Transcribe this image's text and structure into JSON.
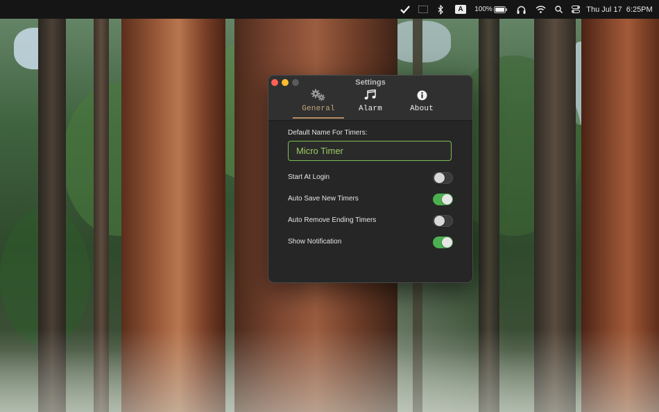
{
  "menubar": {
    "battery_percent": "100%",
    "input_source": "A",
    "datetime": "Thu Jul 17  6:25PM",
    "icons": [
      "checkmark-icon",
      "window-icon",
      "bluetooth-icon",
      "input-source-icon",
      "battery-icon",
      "headphones-icon",
      "wifi-icon",
      "search-icon",
      "control-center-icon"
    ]
  },
  "window": {
    "title": "Settings",
    "tabs": [
      {
        "label": "General",
        "icon": "gears-icon",
        "active": true
      },
      {
        "label": "Alarm",
        "icon": "music-notes-icon",
        "active": false
      },
      {
        "label": "About",
        "icon": "info-icon",
        "active": false
      }
    ],
    "general": {
      "default_name_label": "Default Name For Timers:",
      "default_name_value": "Micro Timer",
      "settings": [
        {
          "label": "Start At Login",
          "enabled": false
        },
        {
          "label": "Auto Save New Timers",
          "enabled": true
        },
        {
          "label": "Auto Remove Ending Timers",
          "enabled": false
        },
        {
          "label": "Show Notification",
          "enabled": true
        }
      ]
    }
  },
  "colors": {
    "accent_tab": "#c5a47c",
    "toggle_on": "#4caf50",
    "input_border": "#7bbf54",
    "input_text": "#9ccc65"
  }
}
